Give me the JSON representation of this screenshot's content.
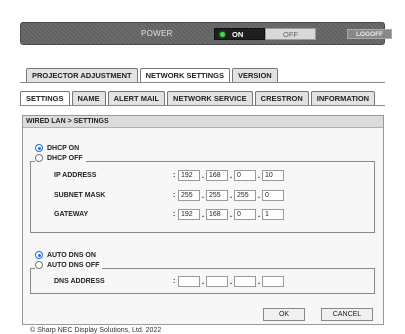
{
  "power": {
    "label": "POWER",
    "on_label": "ON",
    "off_label": "OFF",
    "logoff_label": "LOGOFF"
  },
  "main_tabs": [
    {
      "label": "PROJECTOR ADJUSTMENT",
      "active": false
    },
    {
      "label": "NETWORK SETTINGS",
      "active": true
    },
    {
      "label": "VERSION",
      "active": false
    }
  ],
  "sub_tabs": [
    {
      "label": "SETTINGS",
      "active": true
    },
    {
      "label": "NAME",
      "active": false
    },
    {
      "label": "ALERT MAIL",
      "active": false
    },
    {
      "label": "NETWORK SERVICE",
      "active": false
    },
    {
      "label": "CRESTRON",
      "active": false
    },
    {
      "label": "INFORMATION",
      "active": false
    }
  ],
  "panel": {
    "title": "WIRED LAN > SETTINGS",
    "dhcp_on": "DHCP ON",
    "dhcp_off": "DHCP OFF",
    "dhcp_selected": "DHCP ON",
    "ip_label": "IP ADDRESS",
    "ip": [
      "192",
      "168",
      "0",
      "10"
    ],
    "subnet_label": "SUBNET MASK",
    "subnet": [
      "255",
      "255",
      "255",
      "0"
    ],
    "gateway_label": "GATEWAY",
    "gateway": [
      "192",
      "168",
      "0",
      "1"
    ],
    "auto_dns_on": "AUTO DNS ON",
    "auto_dns_off": "AUTO DNS OFF",
    "dns_selected": "AUTO DNS ON",
    "dns_label": "DNS ADDRESS",
    "dns": [
      "",
      "",
      "",
      ""
    ],
    "colon": ":"
  },
  "buttons": {
    "ok": "OK",
    "cancel": "CANCEL"
  },
  "footer": "© Sharp NEC Display Solutions, Ltd. 2022",
  "colors": {
    "accent": "#1e6fd9",
    "power_led": "#3ddc3d",
    "power_bar": "#636363"
  }
}
